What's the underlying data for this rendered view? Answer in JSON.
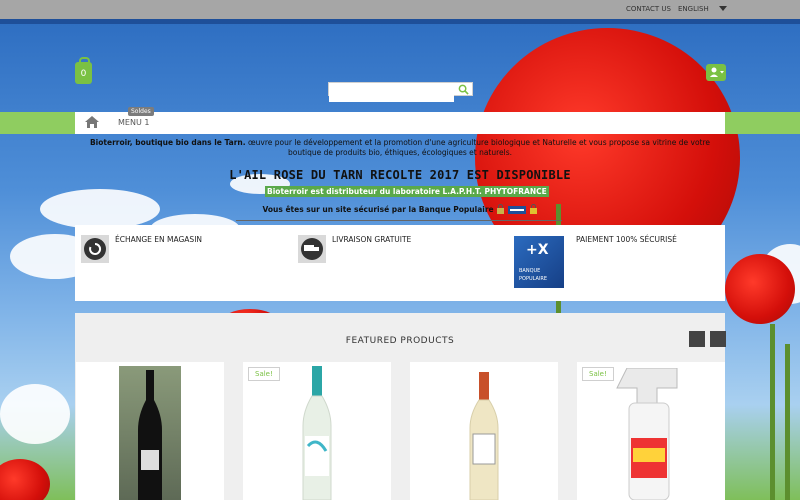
{
  "topbar": {
    "contact": "CONTACT US",
    "language": "ENGLISH"
  },
  "cart": {
    "count": "0"
  },
  "search": {
    "value": "",
    "placeholder": ""
  },
  "menu": {
    "badge": "Soldes",
    "item1": "MENU 1"
  },
  "intro": {
    "brand": "Bioterroir, boutique bio dans le Tarn.",
    "text": " œuvre pour le développement et la promotion d'une agriculture biologique et Naturelle et vous propose sa vitrine de votre boutique de produits bio, éthiques, écologiques et naturels."
  },
  "headline": "L'AIL ROSE DU TARN RECOLTE 2017 EST  DISPONIBLE",
  "distributor": "Bioterroir est distributeur du laboratoire L.A.P.H.T. PHYTOFRANCE",
  "secure": "Vous êtes sur un site sécurisé par la Banque Populaire",
  "features": [
    {
      "label": "ÉCHANGE EN MAGASIN",
      "icon": "refresh-icon"
    },
    {
      "label": "LIVRAISON GRATUITE",
      "icon": "truck-icon"
    },
    {
      "label": "PAIEMENT 100% SÉCURISÉ",
      "icon": "banque-populaire-logo"
    }
  ],
  "bp_logo": {
    "line1": "BANQUE",
    "line2": "POPULAIRE"
  },
  "featured": {
    "title": "FEATURED PRODUCTS"
  },
  "products": [
    {
      "sale": "",
      "kind": "red-wine"
    },
    {
      "sale": "Sale!",
      "kind": "white-wine"
    },
    {
      "sale": "",
      "kind": "white-wine-2"
    },
    {
      "sale": "Sale!",
      "kind": "spray"
    }
  ],
  "colors": {
    "accent": "#7ac143",
    "menu_band": "#8fcd60",
    "topbar": "#a6a6a6",
    "topline": "#1e4f99"
  }
}
